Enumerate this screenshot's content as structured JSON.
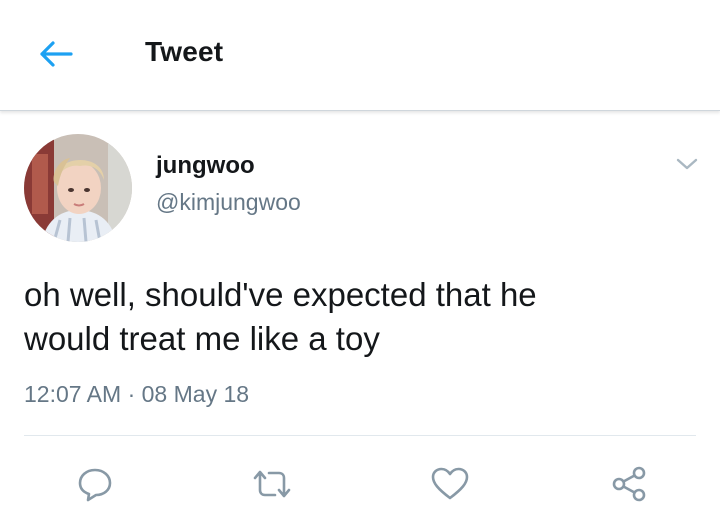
{
  "header": {
    "title": "Tweet",
    "back_icon": "arrow-left-icon",
    "accent_color": "#1da1f2"
  },
  "tweet": {
    "author": {
      "display_name": "jungwoo",
      "handle": "@kimjungwoo"
    },
    "text_lines": [
      "oh well, should've expected that he",
      "would treat me like a toy"
    ],
    "timestamp": "12:07 AM",
    "separator": "·",
    "date": "08 May 18"
  },
  "actions": [
    {
      "icon": "reply-icon"
    },
    {
      "icon": "retweet-icon"
    },
    {
      "icon": "like-icon"
    },
    {
      "icon": "share-icon"
    }
  ],
  "colors": {
    "text_primary": "#14171a",
    "text_secondary": "#657786",
    "icon_gray": "#8899a6"
  }
}
